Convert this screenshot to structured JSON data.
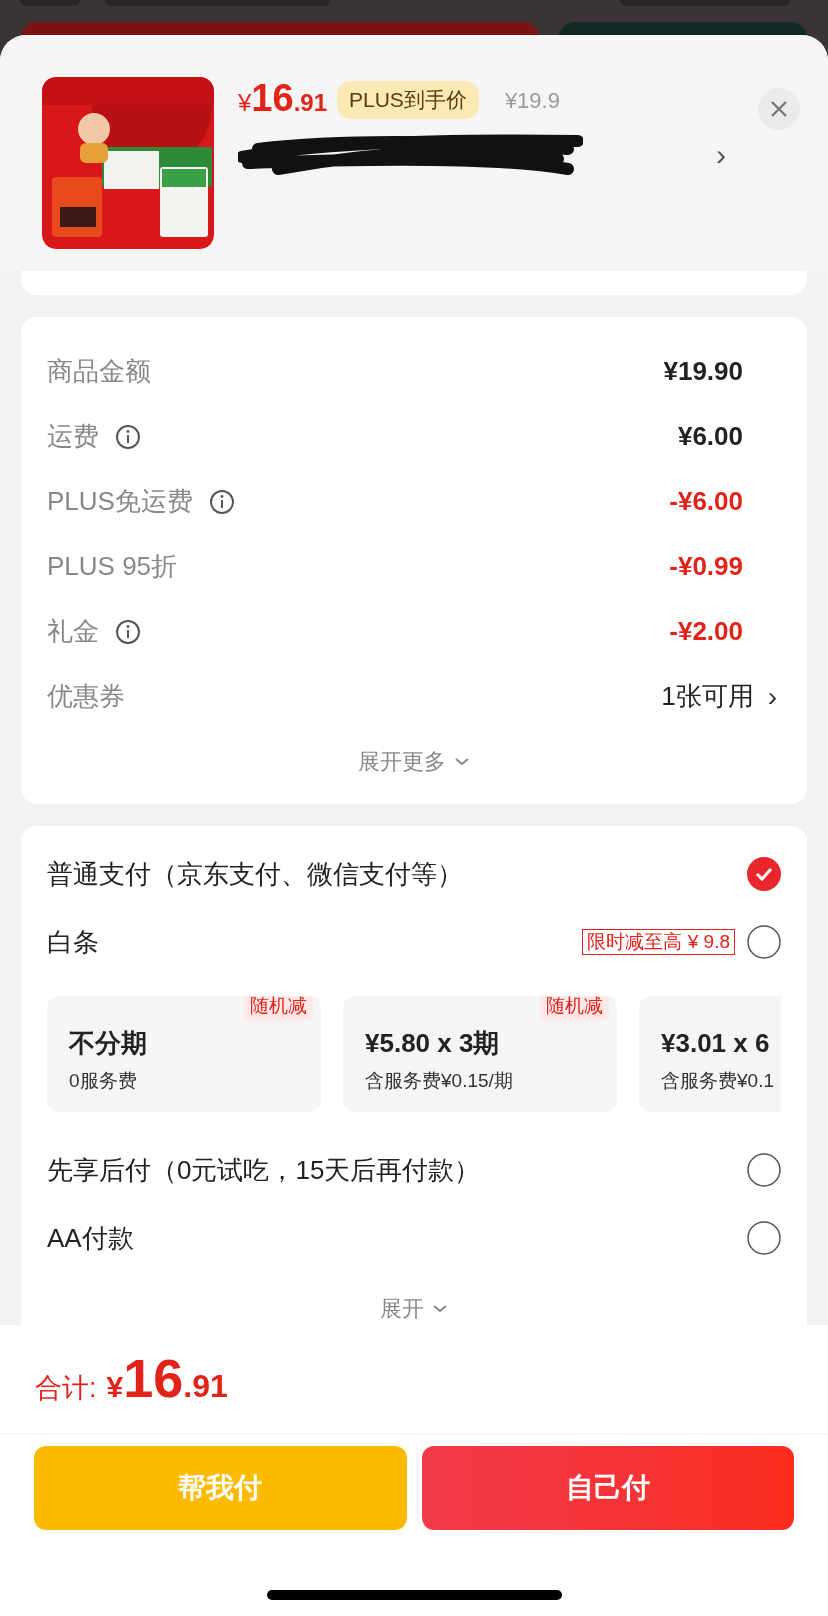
{
  "product": {
    "currency": "¥",
    "price_int": "16",
    "price_dec": ".91",
    "badge": "PLUS到手价",
    "original_price": "¥19.9",
    "chevron": "›"
  },
  "fees": [
    {
      "label": "商品金额",
      "info": false,
      "value": "¥19.90",
      "kind": "amount"
    },
    {
      "label": "运费",
      "info": true,
      "value": "¥6.00",
      "kind": "amount"
    },
    {
      "label": "PLUS免运费",
      "info": true,
      "value": "-¥6.00",
      "kind": "discount"
    },
    {
      "label": "PLUS 95折",
      "info": false,
      "value": "-¥0.99",
      "kind": "discount"
    },
    {
      "label": "礼金",
      "info": true,
      "value": "-¥2.00",
      "kind": "discount"
    },
    {
      "label": "优惠券",
      "info": false,
      "value": "1张可用",
      "kind": "link",
      "chevron": "›"
    }
  ],
  "fees_expand": "展开更多",
  "payment": {
    "methods": [
      {
        "label": "普通支付（京东支付、微信支付等）",
        "selected": true
      },
      {
        "label": "白条",
        "selected": false,
        "promo": "限时减至高 ¥ 9.8",
        "installments": [
          {
            "title": "不分期",
            "subtitle": "0服务费",
            "tag": "随机减"
          },
          {
            "title": "¥5.80 x 3期",
            "subtitle": "含服务费¥0.15/期",
            "tag": "随机减"
          },
          {
            "title": "¥3.01 x 6",
            "subtitle": "含服务费¥0.1"
          }
        ]
      },
      {
        "label": "先享后付（0元试吃，15天后再付款）",
        "selected": false
      },
      {
        "label": "AA付款",
        "selected": false
      }
    ],
    "expand": "展开"
  },
  "footer": {
    "total_label": "合计:",
    "currency": "¥",
    "total_int": "16",
    "total_dec": ".91",
    "buttons": [
      {
        "label": "帮我付",
        "kind": "friend"
      },
      {
        "label": "自己付",
        "kind": "self"
      }
    ]
  }
}
